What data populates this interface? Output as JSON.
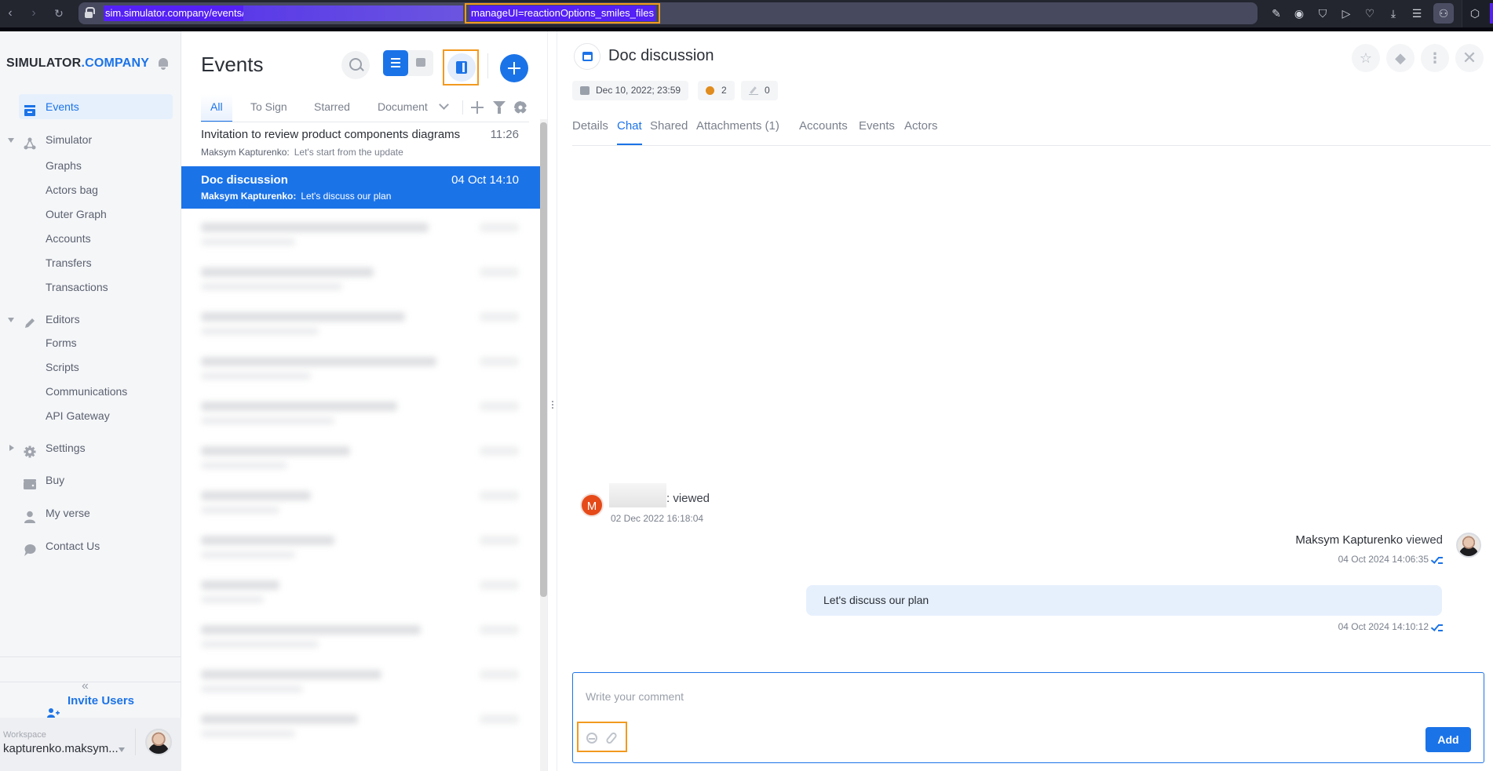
{
  "browser": {
    "url_prefix": "sim.simulator.company/events/",
    "url_suffix": "manageUI=reactionOptions_smiles_files",
    "nav_icons": [
      "back-icon",
      "forward-icon",
      "reload-icon"
    ],
    "toolbar_icons": [
      "edit-icon",
      "camera-icon",
      "shield-icon",
      "send-icon",
      "heart-icon",
      "download-icon",
      "menu-icon",
      "profile-icon",
      "extension-icon"
    ]
  },
  "sidebar": {
    "logo_main": "SIMULATOR",
    "logo_accent": ".COMPANY",
    "items": [
      {
        "label": "Events",
        "icon": "events-icon",
        "active": true
      },
      {
        "label": "Simulator",
        "icon": "simulator-icon",
        "expanded": true,
        "children": [
          "Graphs",
          "Actors bag",
          "Outer Graph",
          "Accounts",
          "Transfers",
          "Transactions"
        ]
      },
      {
        "label": "Editors",
        "icon": "pencil-icon",
        "expanded": true,
        "children": [
          "Forms",
          "Scripts",
          "Communications",
          "API Gateway"
        ]
      },
      {
        "label": "Settings",
        "icon": "gear-icon",
        "expanded": false
      },
      {
        "label": "Buy",
        "icon": "wallet-icon"
      },
      {
        "label": "My verse",
        "icon": "user-icon"
      },
      {
        "label": "Contact Us",
        "icon": "chat-bubble-icon"
      }
    ],
    "collapse_label": "«",
    "invite_label": "Invite Users",
    "workspace_label": "Workspace",
    "workspace_value": "kapturenko.maksym..."
  },
  "events": {
    "title": "Events",
    "tabs": [
      "All",
      "To Sign",
      "Starred",
      "Document"
    ],
    "active_tab": "All",
    "rows": [
      {
        "title": "Invitation to review product components diagrams",
        "time": "11:26",
        "author": "Maksym Kapturenko:",
        "preview": "Let's start from the update",
        "selected": false
      },
      {
        "title": "Doc discussion",
        "time": "04 Oct 14:10",
        "author": "Maksym Kapturenko:",
        "preview": "Let's discuss our plan",
        "selected": true
      }
    ],
    "blurred_row_count": 12
  },
  "detail": {
    "title": "Doc discussion",
    "chips": {
      "date": "Dec 10, 2022; 23:59",
      "coins": "2",
      "edits": "0"
    },
    "tabs": [
      "Details",
      "Chat",
      "Shared",
      "Attachments (1)",
      "Accounts",
      "Events",
      "Actors"
    ],
    "active_tab": "Chat",
    "chat": {
      "first": {
        "avatar_letter": "M",
        "action": ": viewed",
        "time": "02 Dec 2022 16:18:04"
      },
      "second": {
        "author": "Maksym Kapturenko",
        "action": " viewed",
        "time": "04 Oct 2024 14:06:35"
      },
      "message": {
        "text": "Let's discuss our plan",
        "time": "04 Oct 2024 14:10:12"
      }
    },
    "comment": {
      "placeholder": "Write your comment",
      "value": "",
      "submit_label": "Add"
    }
  },
  "colors": {
    "accent": "#1b73e8",
    "highlight": "#f29a1f",
    "avatar_m": "#e64a19"
  }
}
